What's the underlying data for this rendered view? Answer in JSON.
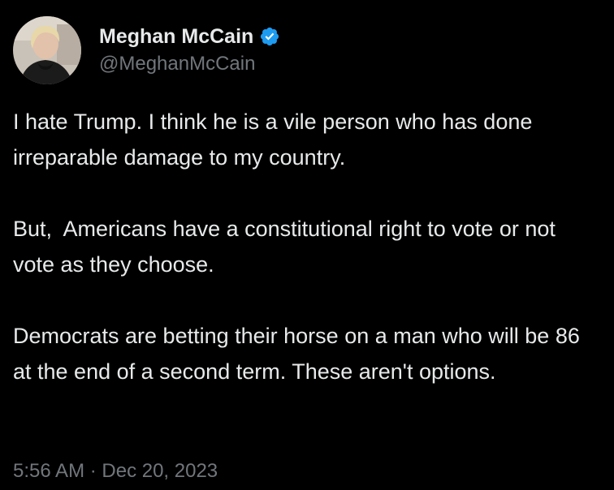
{
  "author": {
    "display_name": "Meghan McCain",
    "handle": "@MeghanMcCain",
    "verified": true,
    "verified_color": "#1d9bf0"
  },
  "tweet": {
    "paragraph_1": "I hate Trump. I think he is a vile person who has done irreparable damage to my country.",
    "paragraph_2": "But,  Americans have a constitutional right to vote or not vote as they choose.",
    "paragraph_3": "Democrats are betting their horse on a man who will be 86 at the end of a second term. These aren't options.",
    "timestamp": "5:56 AM · Dec 20, 2023"
  },
  "icons": {
    "avatar": "profile-photo",
    "verified": "verified-badge-icon"
  },
  "colors": {
    "background": "#000000",
    "text_primary": "#e7e9ea",
    "text_secondary": "#71767b"
  }
}
